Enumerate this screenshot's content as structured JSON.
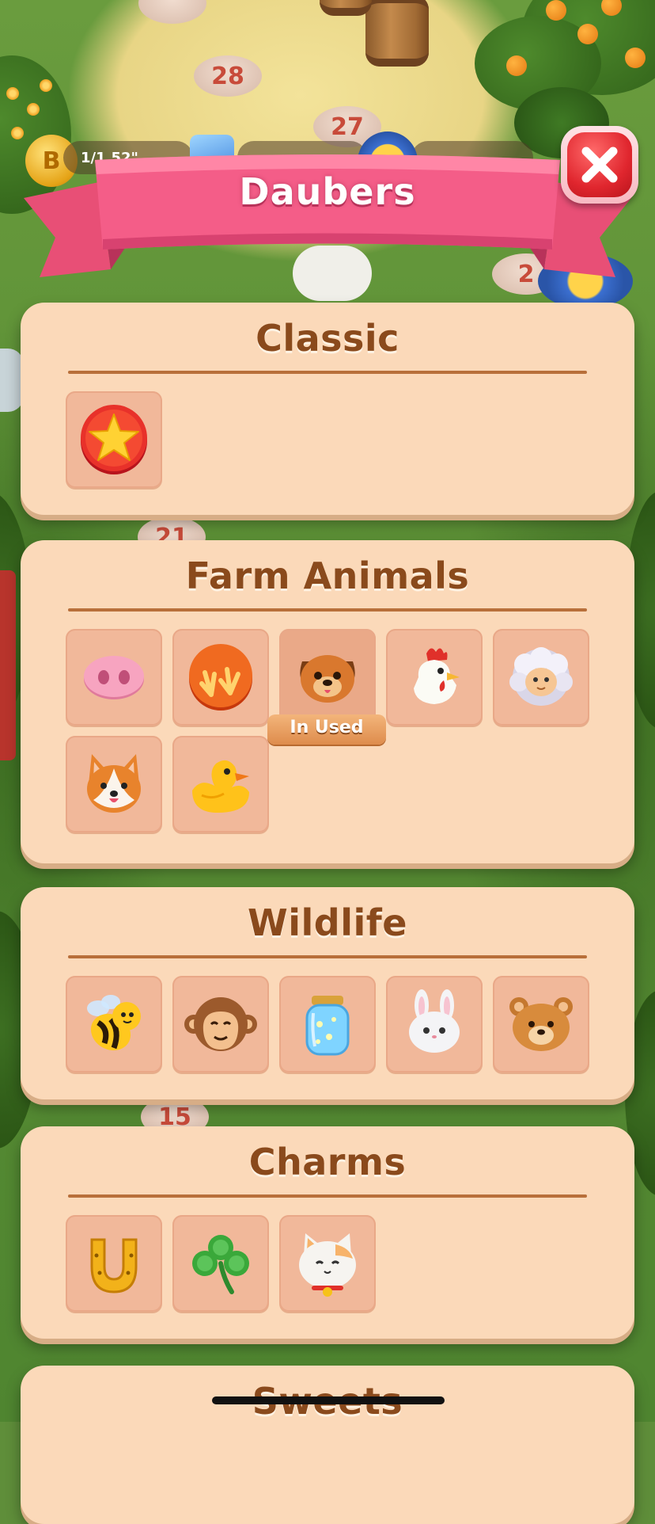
{
  "header": {
    "title": "Daubers",
    "close_icon": "close-x-icon",
    "colors": {
      "ribbon": "#f25c86",
      "close": "#e0262e"
    }
  },
  "background": {
    "board_numbers": [
      "28",
      "27",
      "2",
      "21",
      "15"
    ],
    "currency_text": "1/1.52\"",
    "coin_symbol": "B"
  },
  "sections": [
    {
      "title": "Classic",
      "items": [
        {
          "name": "star",
          "icon": "star-dauber-icon"
        }
      ]
    },
    {
      "title": "Farm Animals",
      "items": [
        {
          "name": "pig-nose",
          "icon": "pig-nose-icon"
        },
        {
          "name": "chicken-feet",
          "icon": "chicken-feet-icon"
        },
        {
          "name": "dog",
          "icon": "dog-face-icon",
          "badge": "In Used"
        },
        {
          "name": "rooster",
          "icon": "rooster-icon"
        },
        {
          "name": "sheep",
          "icon": "sheep-icon"
        },
        {
          "name": "corgi",
          "icon": "corgi-icon"
        },
        {
          "name": "duck",
          "icon": "duck-icon"
        }
      ]
    },
    {
      "title": "Wildlife",
      "items": [
        {
          "name": "bee",
          "icon": "bee-icon"
        },
        {
          "name": "monkey",
          "icon": "monkey-icon"
        },
        {
          "name": "firefly-jar",
          "icon": "jar-icon"
        },
        {
          "name": "bunny",
          "icon": "bunny-icon"
        },
        {
          "name": "bear",
          "icon": "bear-icon"
        }
      ]
    },
    {
      "title": "Charms",
      "items": [
        {
          "name": "horseshoe",
          "icon": "horseshoe-icon"
        },
        {
          "name": "clover",
          "icon": "clover-icon"
        },
        {
          "name": "lucky-cat",
          "icon": "lucky-cat-icon"
        }
      ]
    },
    {
      "title": "Sweets",
      "items": []
    }
  ]
}
